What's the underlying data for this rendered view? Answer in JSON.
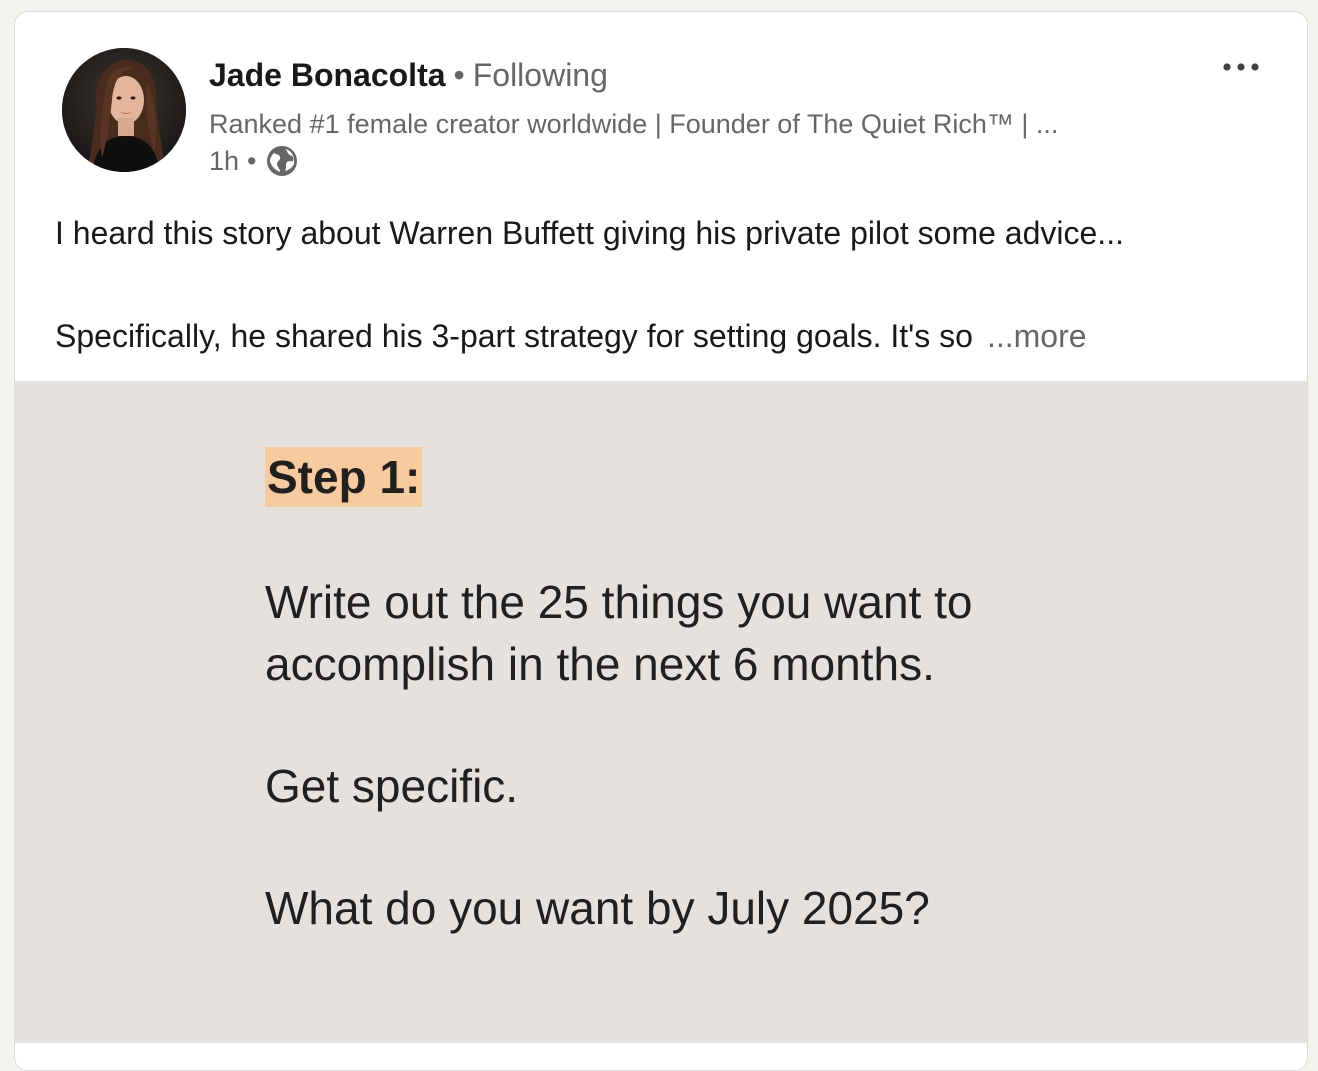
{
  "post": {
    "author": {
      "name": "Jade Bonacolta",
      "separator": "•",
      "follow_status": "Following",
      "headline": "Ranked #1 female creator worldwide | Founder of The Quiet Rich™ | ...",
      "time": "1h",
      "time_separator": "•",
      "visibility_icon": "globe-icon",
      "avatar_icon": "profile-photo"
    },
    "menu_icon": "more-horizontal-icon",
    "body": {
      "line1": "I heard this story about Warren Buffett giving his private pilot some advice...",
      "line2": "Specifically, he shared his 3-part strategy for setting goals. It's so",
      "more_label": "...more"
    },
    "slide": {
      "heading": "Step 1:",
      "para1_line1": "Write out the 25 things you want to",
      "para1_line2": "accomplish in the next 6 months.",
      "para2": "Get specific.",
      "para3": "What do you want by July 2025?",
      "background_color": "#e5e1df",
      "highlight_color": "#f7cb9e"
    }
  }
}
